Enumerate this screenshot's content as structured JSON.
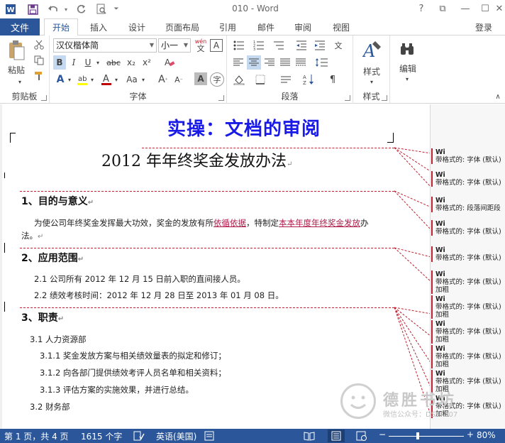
{
  "window": {
    "title": "010 - Word",
    "help": "?",
    "restore": "⧉",
    "minimize": "—",
    "maximize": "☐",
    "close": "✕"
  },
  "tabs": {
    "file": "文件",
    "items": [
      {
        "label": "开始",
        "active": true
      },
      {
        "label": "插入"
      },
      {
        "label": "设计"
      },
      {
        "label": "页面布局"
      },
      {
        "label": "引用"
      },
      {
        "label": "邮件"
      },
      {
        "label": "审阅"
      },
      {
        "label": "视图"
      }
    ],
    "login": "登录"
  },
  "ribbon": {
    "clipboard": {
      "label": "剪贴板",
      "paste": "粘贴"
    },
    "font": {
      "label": "字体",
      "font_name": "汉仪楷体简",
      "font_size": "小一",
      "wen": "wén",
      "wen_char": "文",
      "bold": "B",
      "italic": "I",
      "underline": "U",
      "strike": "abc",
      "sub": "x₂",
      "sup": "x²",
      "grow": "A",
      "shrink": "A",
      "case": "Aa",
      "clear": "A",
      "shade": "A"
    },
    "paragraph": {
      "label": "段落"
    },
    "styles": {
      "label": "样式",
      "button": "样式"
    },
    "editing": {
      "button": "编辑"
    }
  },
  "document": {
    "banner": "实操：文档的审阅",
    "title": "2012 年年终奖金发放办法",
    "para_mark": "↵",
    "s1": {
      "heading": "1、目的与意义",
      "body_a": "为使公司年终奖金发挥最大功效，奖金的发放有所",
      "body_ins1": "依循依据",
      "body_b": "，特制定",
      "body_ins2": "本本年度年终奖金发放",
      "body_c": "办",
      "body_d": "法。"
    },
    "s2": {
      "heading": "2、应用范围",
      "line1": "2.1 公司所有 2012 年 12 月 15 日前入职的直间接人员。",
      "line2": "2.2 绩效考核时间：2012 年 12 月 28 日至 2013 年 01 月 08 日。"
    },
    "s3": {
      "heading": "3、职责",
      "l1": "3.1 人力资源部",
      "l2": "3.1.1 奖金发放方案与相关绩效量表的拟定和修订；",
      "l3": "3.1.2 向各部门提供绩效考评人员名单和相关资料；",
      "l4": "3.1.3 评估方案的实施效果，并进行总结。",
      "l5": "3.2 财务部"
    }
  },
  "comments": [
    {
      "head": "Wi",
      "text": "带格式的: 字体 (默认)"
    },
    {
      "head": "Wi",
      "text": "带格式的: 字体 (默认)"
    },
    {
      "head": "Wi",
      "text": "带格式的: 段落间距段"
    },
    {
      "head": "Wi",
      "text": "带格式的: 字体 (默认)"
    },
    {
      "head": "Wi",
      "text": "带格式的: 字体 (默认)"
    },
    {
      "head": "Wi",
      "text": "带格式的: 字体 (默认)",
      "extra": "加粗"
    },
    {
      "head": "Wi",
      "text": "带格式的: 字体 (默认)",
      "extra": "加粗"
    },
    {
      "head": "Wi",
      "text": "带格式的: 字体 (默认)",
      "extra": "加粗"
    },
    {
      "head": "Wi",
      "text": "带格式的: 字体 (默认)",
      "extra": "加粗"
    },
    {
      "head": "Wi",
      "text": "带格式的: 字体 (默认)",
      "extra": "加粗"
    },
    {
      "head": "Wi",
      "text": "带格式的: 字体 (默认)",
      "extra": "加粗"
    }
  ],
  "watermark": {
    "text": "德胜书坊",
    "sub": "微信公众号：DSSF007"
  },
  "status": {
    "page": "第 1 页，共 4 页",
    "words": "1615 个字",
    "language": "英语(美国)",
    "zoom": "80%",
    "zoom_level": 0.8
  }
}
